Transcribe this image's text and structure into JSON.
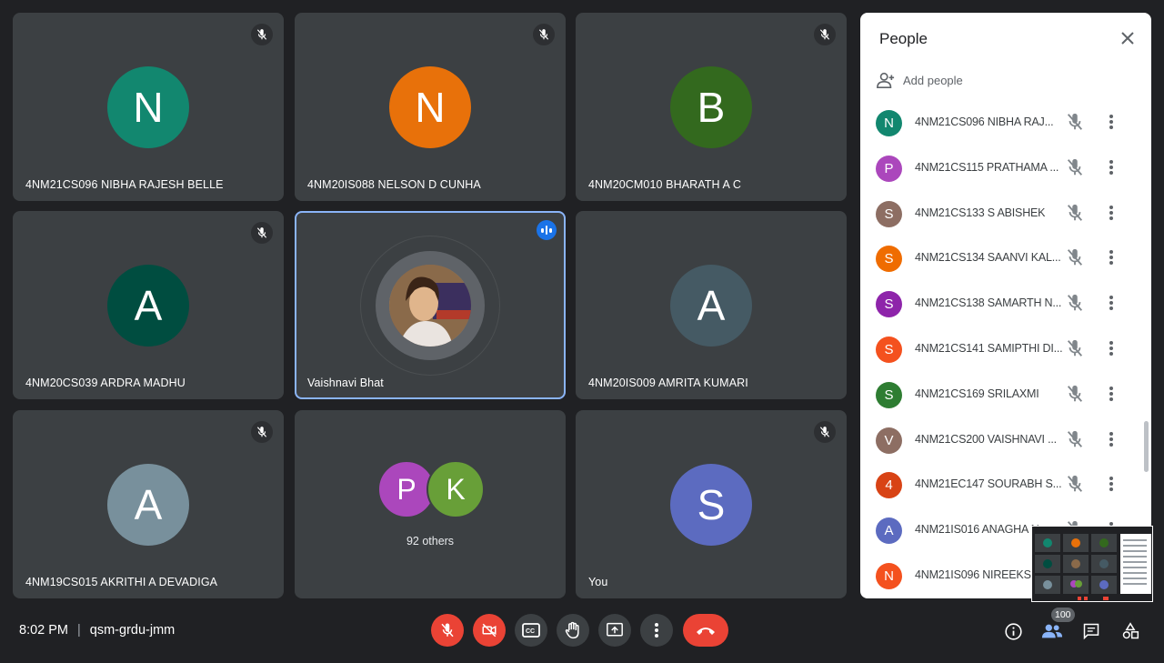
{
  "tiles": [
    {
      "name": "4NM21CS096 NIBHA RAJESH BELLE",
      "initial": "N",
      "color": "#12876f"
    },
    {
      "name": "4NM20IS088 NELSON D CUNHA",
      "initial": "N",
      "color": "#e8710a"
    },
    {
      "name": "4NM20CM010 BHARATH A C",
      "initial": "B",
      "color": "#33691e"
    },
    {
      "name": "4NM20CS039 ARDRA MADHU",
      "initial": "A",
      "color": "#004d40"
    },
    {
      "name": "Vaishnavi Bhat"
    },
    {
      "name": "4NM20IS009 AMRITA KUMARI",
      "initial": "A",
      "color": "#455a64"
    },
    {
      "name": "4NM19CS015 AKRITHI A DEVADIGA",
      "initial": "A",
      "color": "#78909c"
    },
    {
      "others_label": "92 others",
      "avatars": [
        {
          "initial": "P",
          "color": "#ab47bc"
        },
        {
          "initial": "K",
          "color": "#689f38"
        }
      ]
    },
    {
      "name": "You",
      "initial": "S",
      "color": "#5c6bc0"
    }
  ],
  "panel": {
    "title": "People",
    "add_people": "Add people",
    "people": [
      {
        "initial": "N",
        "name": "4NM21CS096 NIBHA RAJ...",
        "color": "#12876f"
      },
      {
        "initial": "P",
        "name": "4NM21CS115 PRATHAMA ...",
        "color": "#ab47bc"
      },
      {
        "initial": "S",
        "name": "4NM21CS133 S ABISHEK",
        "color": "#8d6e63"
      },
      {
        "initial": "S",
        "name": "4NM21CS134 SAANVI KAL...",
        "color": "#ef6c00"
      },
      {
        "initial": "S",
        "name": "4NM21CS138 SAMARTH N...",
        "color": "#8e24aa"
      },
      {
        "initial": "S",
        "name": "4NM21CS141 SAMIPTHI DI...",
        "color": "#f4511e"
      },
      {
        "initial": "S",
        "name": "4NM21CS169 SRILAXMI",
        "color": "#2e7d32"
      },
      {
        "initial": "V",
        "name": "4NM21CS200 VAISHNAVI ...",
        "color": "#8d6e63"
      },
      {
        "initial": "4",
        "name": "4NM21EC147 SOURABH S...",
        "color": "#d84315"
      },
      {
        "initial": "A",
        "name": "4NM21IS016 ANAGHA N...",
        "color": "#5c6bc0"
      },
      {
        "initial": "N",
        "name": "4NM21IS096 NIREEKSHA...",
        "color": "#f4511e"
      }
    ]
  },
  "bottom": {
    "time": "8:02 PM",
    "separator": "|",
    "meeting_code": "qsm-grdu-jmm",
    "people_count": "100"
  }
}
